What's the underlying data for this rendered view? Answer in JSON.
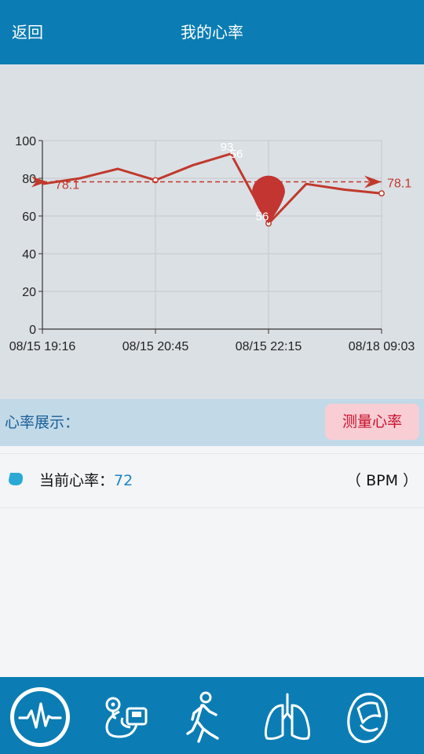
{
  "header": {
    "back_label": "返回",
    "title": "我的心率"
  },
  "chart_data": {
    "type": "line",
    "x_tick_labels": [
      "08/15 19:16",
      "08/15 20:45",
      "08/15 22:15",
      "08/18 09:03"
    ],
    "y_ticks": [
      0,
      20,
      40,
      60,
      80,
      100
    ],
    "ylim": [
      0,
      100
    ],
    "grid": true,
    "series": [
      {
        "values": [
          77,
          80,
          85,
          79,
          87,
          93,
          56,
          77,
          74,
          72
        ],
        "color": "#c0392b"
      }
    ],
    "data_labels": [
      "93",
      "56",
      "56"
    ],
    "average": {
      "value": 78.1,
      "label": "78.1"
    },
    "highlight_point_index": 6
  },
  "section": {
    "label": "心率展示：",
    "measure_button": "测量心率"
  },
  "current": {
    "label": "当前心率：",
    "value": "72",
    "unit": "（ BPM ）"
  },
  "tabs": [
    {
      "icon": "heart-rate-icon",
      "active": true
    },
    {
      "icon": "blood-pressure-icon",
      "active": false
    },
    {
      "icon": "walking-icon",
      "active": false
    },
    {
      "icon": "lungs-icon",
      "active": false
    },
    {
      "icon": "wristband-icon",
      "active": false
    }
  ],
  "colors": {
    "primary": "#0b7db4",
    "line": "#c0392b",
    "value_text": "#1b86c4",
    "button_bg": "#f8cdd3",
    "button_text": "#c8102e"
  }
}
